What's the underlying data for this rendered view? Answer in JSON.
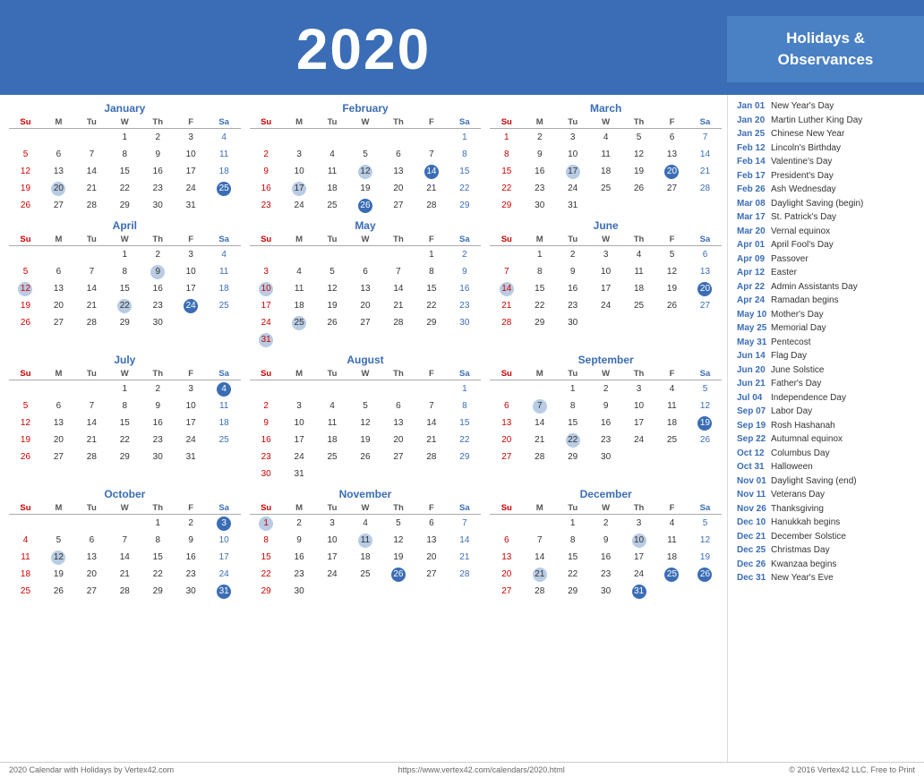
{
  "header": {
    "year": "2020",
    "holidays_title": "Holidays &\nObservances"
  },
  "months": [
    {
      "name": "January",
      "startDay": 3,
      "days": 31,
      "highlighted": [
        20
      ],
      "dark_blue": [
        25
      ],
      "weeks": [
        [
          "",
          "",
          "",
          "1",
          "2",
          "3",
          "4"
        ],
        [
          "5",
          "6",
          "7",
          "8",
          "9",
          "10",
          "11"
        ],
        [
          "12",
          "13",
          "14",
          "15",
          "16",
          "17",
          "18"
        ],
        [
          "19",
          "20",
          "21",
          "22",
          "23",
          "24",
          "25"
        ],
        [
          "26",
          "27",
          "28",
          "29",
          "30",
          "31",
          ""
        ]
      ]
    },
    {
      "name": "February",
      "startDay": 6,
      "weeks": [
        [
          "",
          "",
          "",
          "",
          "",
          "",
          "1"
        ],
        [
          "2",
          "3",
          "4",
          "5",
          "6",
          "7",
          "8"
        ],
        [
          "9",
          "10",
          "11",
          "12",
          "13",
          "14",
          "15"
        ],
        [
          "16",
          "17",
          "18",
          "19",
          "20",
          "21",
          "22"
        ],
        [
          "23",
          "24",
          "25",
          "26",
          "27",
          "28",
          "29"
        ]
      ],
      "highlighted": [
        12,
        17
      ],
      "dark_blue": [
        14,
        26
      ]
    },
    {
      "name": "March",
      "startDay": 0,
      "weeks": [
        [
          "1",
          "2",
          "3",
          "4",
          "5",
          "6",
          "7"
        ],
        [
          "8",
          "9",
          "10",
          "11",
          "12",
          "13",
          "14"
        ],
        [
          "15",
          "16",
          "17",
          "18",
          "19",
          "20",
          "21"
        ],
        [
          "22",
          "23",
          "24",
          "25",
          "26",
          "27",
          "28"
        ],
        [
          "29",
          "30",
          "31",
          "",
          "",
          "",
          ""
        ]
      ],
      "highlighted": [
        17
      ],
      "dark_blue": [
        20
      ]
    },
    {
      "name": "April",
      "startDay": 3,
      "weeks": [
        [
          "",
          "",
          "",
          "1",
          "2",
          "3",
          "4"
        ],
        [
          "5",
          "6",
          "7",
          "8",
          "9",
          "10",
          "11"
        ],
        [
          "12",
          "13",
          "14",
          "15",
          "16",
          "17",
          "18"
        ],
        [
          "19",
          "20",
          "21",
          "22",
          "23",
          "24",
          "25"
        ],
        [
          "26",
          "27",
          "28",
          "29",
          "30",
          "",
          ""
        ]
      ],
      "highlighted": [
        9,
        12,
        22
      ],
      "dark_blue": [
        24
      ]
    },
    {
      "name": "May",
      "startDay": 5,
      "weeks": [
        [
          "",
          "",
          "",
          "",
          "",
          "1",
          "2"
        ],
        [
          "3",
          "4",
          "5",
          "6",
          "7",
          "8",
          "9"
        ],
        [
          "10",
          "11",
          "12",
          "13",
          "14",
          "15",
          "16"
        ],
        [
          "17",
          "18",
          "19",
          "20",
          "21",
          "22",
          "23"
        ],
        [
          "24",
          "25",
          "26",
          "27",
          "28",
          "29",
          "30"
        ],
        [
          "31",
          "",
          "",
          "",
          "",
          "",
          ""
        ]
      ],
      "highlighted": [
        10,
        25,
        31
      ],
      "dark_blue": []
    },
    {
      "name": "June",
      "startDay": 1,
      "weeks": [
        [
          "",
          "1",
          "2",
          "3",
          "4",
          "5",
          "6"
        ],
        [
          "7",
          "8",
          "9",
          "10",
          "11",
          "12",
          "13"
        ],
        [
          "14",
          "15",
          "16",
          "17",
          "18",
          "19",
          "20"
        ],
        [
          "21",
          "22",
          "23",
          "24",
          "25",
          "26",
          "27"
        ],
        [
          "28",
          "29",
          "30",
          "",
          "",
          "",
          ""
        ]
      ],
      "highlighted": [
        14
      ],
      "dark_blue": [
        20
      ]
    },
    {
      "name": "July",
      "startDay": 3,
      "weeks": [
        [
          "",
          "",
          "",
          "1",
          "2",
          "3",
          "4"
        ],
        [
          "5",
          "6",
          "7",
          "8",
          "9",
          "10",
          "11"
        ],
        [
          "12",
          "13",
          "14",
          "15",
          "16",
          "17",
          "18"
        ],
        [
          "19",
          "20",
          "21",
          "22",
          "23",
          "24",
          "25"
        ],
        [
          "26",
          "27",
          "28",
          "29",
          "30",
          "31",
          ""
        ]
      ],
      "highlighted": [],
      "dark_blue": [
        4
      ]
    },
    {
      "name": "August",
      "startDay": 6,
      "weeks": [
        [
          "",
          "",
          "",
          "",
          "",
          "",
          "1"
        ],
        [
          "2",
          "3",
          "4",
          "5",
          "6",
          "7",
          "8"
        ],
        [
          "9",
          "10",
          "11",
          "12",
          "13",
          "14",
          "15"
        ],
        [
          "16",
          "17",
          "18",
          "19",
          "20",
          "21",
          "22"
        ],
        [
          "23",
          "24",
          "25",
          "26",
          "27",
          "28",
          "29"
        ],
        [
          "30",
          "31",
          "",
          "",
          "",
          "",
          ""
        ]
      ],
      "highlighted": [],
      "dark_blue": []
    },
    {
      "name": "September",
      "startDay": 2,
      "weeks": [
        [
          "",
          "",
          "1",
          "2",
          "3",
          "4",
          "5"
        ],
        [
          "6",
          "7",
          "8",
          "9",
          "10",
          "11",
          "12"
        ],
        [
          "13",
          "14",
          "15",
          "16",
          "17",
          "18",
          "19"
        ],
        [
          "20",
          "21",
          "22",
          "23",
          "24",
          "25",
          "26"
        ],
        [
          "27",
          "28",
          "29",
          "30",
          "",
          "",
          ""
        ]
      ],
      "highlighted": [
        7,
        22
      ],
      "dark_blue": [
        19
      ]
    },
    {
      "name": "October",
      "startDay": 4,
      "weeks": [
        [
          "",
          "",
          "",
          "",
          "1",
          "2",
          "3"
        ],
        [
          "4",
          "5",
          "6",
          "7",
          "8",
          "9",
          "10"
        ],
        [
          "11",
          "12",
          "13",
          "14",
          "15",
          "16",
          "17"
        ],
        [
          "18",
          "19",
          "20",
          "21",
          "22",
          "23",
          "24"
        ],
        [
          "25",
          "26",
          "27",
          "28",
          "29",
          "30",
          "31"
        ]
      ],
      "highlighted": [
        12
      ],
      "dark_blue": [
        3,
        31
      ]
    },
    {
      "name": "November",
      "startDay": 0,
      "weeks": [
        [
          "1",
          "2",
          "3",
          "4",
          "5",
          "6",
          "7"
        ],
        [
          "8",
          "9",
          "10",
          "11",
          "12",
          "13",
          "14"
        ],
        [
          "15",
          "16",
          "17",
          "18",
          "19",
          "20",
          "21"
        ],
        [
          "22",
          "23",
          "24",
          "25",
          "26",
          "27",
          "28"
        ],
        [
          "29",
          "30",
          "",
          "",
          "",
          "",
          ""
        ]
      ],
      "highlighted": [
        1,
        11,
        26
      ],
      "dark_blue": [
        26
      ]
    },
    {
      "name": "December",
      "startDay": 2,
      "weeks": [
        [
          "",
          "",
          "1",
          "2",
          "3",
          "4",
          "5"
        ],
        [
          "6",
          "7",
          "8",
          "9",
          "10",
          "11",
          "12"
        ],
        [
          "13",
          "14",
          "15",
          "16",
          "17",
          "18",
          "19"
        ],
        [
          "20",
          "21",
          "22",
          "23",
          "24",
          "25",
          "26"
        ],
        [
          "27",
          "28",
          "29",
          "30",
          "31",
          "",
          ""
        ]
      ],
      "highlighted": [
        10,
        21
      ],
      "dark_blue": [
        25,
        26,
        31
      ]
    }
  ],
  "holidays": [
    {
      "date": "Jan 01",
      "name": "New Year's Day"
    },
    {
      "date": "Jan 20",
      "name": "Martin Luther King Day"
    },
    {
      "date": "Jan 25",
      "name": "Chinese New Year"
    },
    {
      "date": "Feb 12",
      "name": "Lincoln's Birthday"
    },
    {
      "date": "Feb 14",
      "name": "Valentine's Day"
    },
    {
      "date": "Feb 17",
      "name": "President's Day"
    },
    {
      "date": "Feb 26",
      "name": "Ash Wednesday"
    },
    {
      "date": "Mar 08",
      "name": "Daylight Saving (begin)"
    },
    {
      "date": "Mar 17",
      "name": "St. Patrick's Day"
    },
    {
      "date": "Mar 20",
      "name": "Vernal equinox"
    },
    {
      "date": "Apr 01",
      "name": "April Fool's Day"
    },
    {
      "date": "Apr 09",
      "name": "Passover"
    },
    {
      "date": "Apr 12",
      "name": "Easter"
    },
    {
      "date": "Apr 22",
      "name": "Admin Assistants Day"
    },
    {
      "date": "Apr 24",
      "name": "Ramadan begins"
    },
    {
      "date": "May 10",
      "name": "Mother's Day"
    },
    {
      "date": "May 25",
      "name": "Memorial Day"
    },
    {
      "date": "May 31",
      "name": "Pentecost"
    },
    {
      "date": "Jun 14",
      "name": "Flag Day"
    },
    {
      "date": "Jun 20",
      "name": "June Solstice"
    },
    {
      "date": "Jun 21",
      "name": "Father's Day"
    },
    {
      "date": "Jul 04",
      "name": "Independence Day"
    },
    {
      "date": "Sep 07",
      "name": "Labor Day"
    },
    {
      "date": "Sep 19",
      "name": "Rosh Hashanah"
    },
    {
      "date": "Sep 22",
      "name": "Autumnal equinox"
    },
    {
      "date": "Oct 12",
      "name": "Columbus Day"
    },
    {
      "date": "Oct 31",
      "name": "Halloween"
    },
    {
      "date": "Nov 01",
      "name": "Daylight Saving (end)"
    },
    {
      "date": "Nov 11",
      "name": "Veterans Day"
    },
    {
      "date": "Nov 26",
      "name": "Thanksgiving"
    },
    {
      "date": "Dec 10",
      "name": "Hanukkah begins"
    },
    {
      "date": "Dec 21",
      "name": "December Solstice"
    },
    {
      "date": "Dec 25",
      "name": "Christmas Day"
    },
    {
      "date": "Dec 26",
      "name": "Kwanzaa begins"
    },
    {
      "date": "Dec 31",
      "name": "New Year's Eve"
    }
  ],
  "footer": {
    "left": "2020 Calendar with Holidays by Vertex42.com",
    "center": "https://www.vertex42.com/calendars/2020.html",
    "right": "© 2016 Vertex42 LLC. Free to Print"
  }
}
